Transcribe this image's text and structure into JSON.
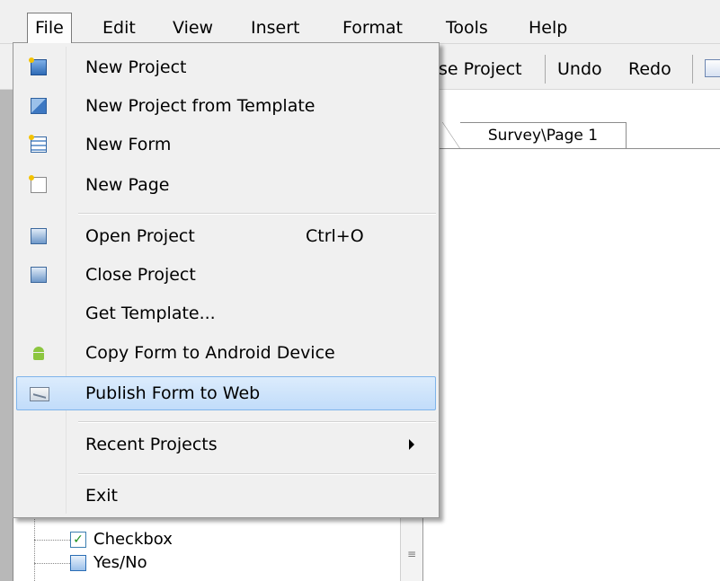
{
  "menubar": {
    "items": [
      "File",
      "Edit",
      "View",
      "Insert",
      "Format",
      "Tools",
      "Help"
    ],
    "open_item": "File"
  },
  "toolbar": {
    "close_project_partial": "se Project",
    "undo": "Undo",
    "redo": "Redo"
  },
  "file_menu": {
    "items": [
      {
        "label": "New Project",
        "icon": "new-project-icon"
      },
      {
        "label": "New Project from Template",
        "icon": "template-icon"
      },
      {
        "label": "New Form",
        "icon": "new-form-icon"
      },
      {
        "label": "New Page",
        "icon": "new-page-icon"
      },
      {
        "label": "Open Project",
        "shortcut": "Ctrl+O",
        "icon": "open-project-icon"
      },
      {
        "label": "Close Project",
        "icon": "close-project-icon"
      },
      {
        "label": "Get Template...",
        "icon": ""
      },
      {
        "label": "Copy Form to Android Device",
        "icon": "android-icon"
      },
      {
        "label": "Publish Form to Web",
        "icon": "publish-web-icon",
        "highlighted": true
      },
      {
        "label": "Recent Projects",
        "submenu": true
      },
      {
        "label": "Exit"
      }
    ]
  },
  "editor": {
    "tab_label": "Survey\\Page 1"
  },
  "tree": {
    "items": [
      {
        "label": "Checkbox",
        "icon": "checkbox-icon"
      },
      {
        "label": "Yes/No",
        "icon": "yes-no-icon"
      }
    ]
  },
  "colors": {
    "menu_background": "#f0f0f0",
    "highlight_fill": "#c1dcfa",
    "highlight_border": "#7eb4ea",
    "android_green": "#8cc63f"
  }
}
